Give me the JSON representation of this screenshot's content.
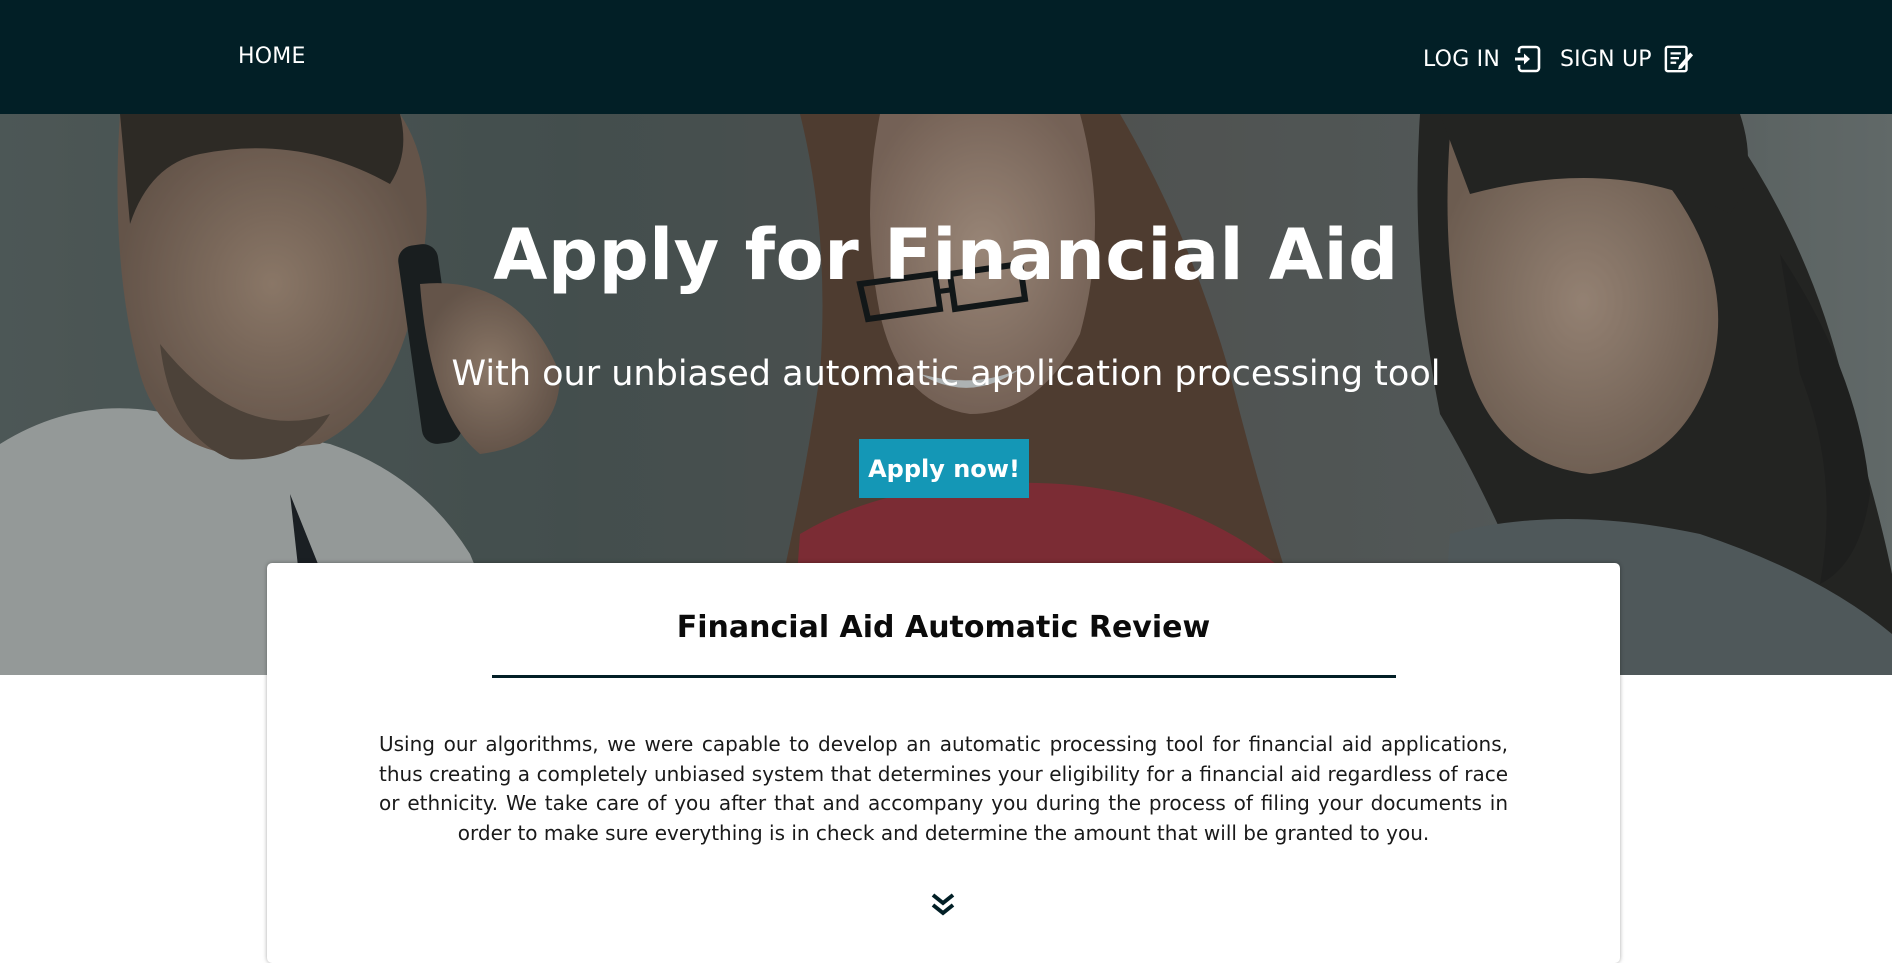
{
  "nav": {
    "home_label": "HOME",
    "login_label": "LOG IN",
    "signup_label": "SIGN UP",
    "login_icon": "login-arrow-icon",
    "signup_icon": "edit-document-icon"
  },
  "hero": {
    "title": "Apply for Financial Aid",
    "subtitle": "With our unbiased automatic application processing tool",
    "cta_label": "Apply now!"
  },
  "card": {
    "title": "Financial Aid Automatic Review",
    "body": "Using our algorithms, we were capable to develop an automatic processing tool for financial aid applications, thus creating a completely unbiased system that determines your eligibility for a financial aid regardless of race or ethnicity. We take care of you after that and accompany you during the process of filing your documents in order to make sure everything is in check and determine the amount that will be granted to you.",
    "scroll_icon": "double-chevron-down-icon"
  },
  "colors": {
    "navbar": "#021f26",
    "accent": "#1497b6",
    "text": "#1a1a1a"
  }
}
